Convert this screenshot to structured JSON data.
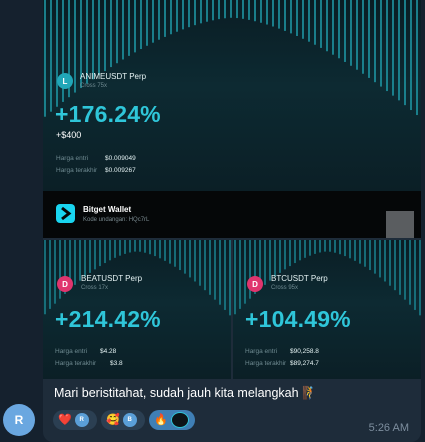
{
  "cards": {
    "top": {
      "coin_letter": "L",
      "pair": "ANIMEUSDT Perp",
      "mode": "Cross 75x",
      "pct": "+176.24%",
      "pnl": "+$400",
      "entry_label": "Harga entri",
      "entry_value": "$0.009049",
      "last_label": "Harga terakhir",
      "last_value": "$0.009267"
    },
    "left": {
      "coin_letter": "D",
      "pair": "BEATUSDT Perp",
      "mode": "Cross 17x",
      "pct": "+214.42%",
      "entry_label": "Harga entri",
      "entry_value": "$4.28",
      "last_label": "Harga terakhir",
      "last_value": "$3.8"
    },
    "right": {
      "coin_letter": "D",
      "pair": "BTCUSDT Perp",
      "mode": "Cross 95x",
      "pct": "+104.49%",
      "entry_label": "Harga entri",
      "entry_value": "$90,258.8",
      "last_label": "Harga terakhir",
      "last_value": "$89,274.7"
    }
  },
  "wallet": {
    "title": "Bitget Wallet",
    "subtitle": "Kode undangan: HQc7rL"
  },
  "message": {
    "caption": "Mari beristitahat, sudah jauh kita melangkah 🧗",
    "time": "5:26 AM",
    "sender_initial": "R"
  },
  "reactions": [
    {
      "emoji": "❤️",
      "avatar": "R"
    },
    {
      "emoji": "🥰",
      "avatar": "B"
    },
    {
      "emoji": "🔥",
      "avatar": ""
    }
  ],
  "colors": {
    "accent_pct": "#2fc6d9",
    "wallet_logo": "#19d5f0",
    "bubble": "#1e2c3a",
    "background": "#15212e"
  }
}
